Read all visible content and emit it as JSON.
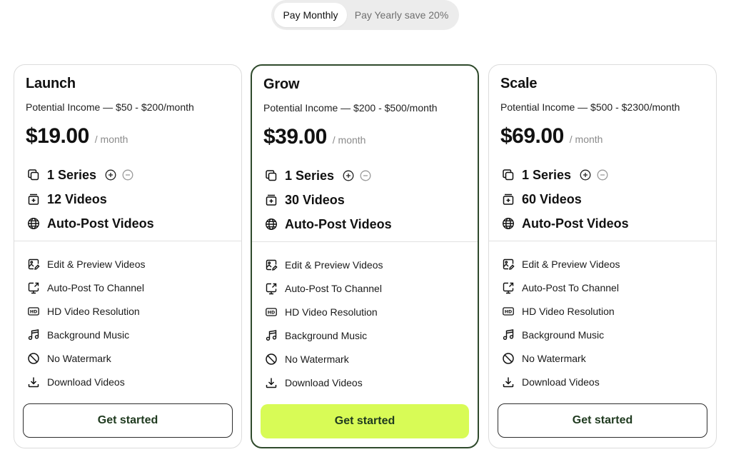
{
  "toggle": {
    "monthly": "Pay Monthly",
    "yearly": "Pay Yearly save 20%"
  },
  "plans": [
    {
      "name": "Launch",
      "income": "Potential Income — $50 - $200/month",
      "price": "$19.00",
      "per": "/ month",
      "series": "1 Series",
      "videos": "12 Videos",
      "autopost": "Auto-Post Videos",
      "cta": "Get started"
    },
    {
      "name": "Grow",
      "income": "Potential Income —  $200 - $500/month",
      "price": "$39.00",
      "per": "/ month",
      "series": "1 Series",
      "videos": "30 Videos",
      "autopost": "Auto-Post Videos",
      "cta": "Get started"
    },
    {
      "name": "Scale",
      "income": "Potential Income —  $500 - $2300/month",
      "price": "$69.00",
      "per": "/ month",
      "series": "1 Series",
      "videos": "60 Videos",
      "autopost": "Auto-Post Videos",
      "cta": "Get started"
    }
  ],
  "features": [
    {
      "label": "Edit & Preview Videos",
      "icon": "image-edit-icon"
    },
    {
      "label": "Auto-Post To Channel",
      "icon": "monitor-share-icon"
    },
    {
      "label": "HD Video Resolution",
      "icon": "hd-icon"
    },
    {
      "label": "Background Music",
      "icon": "music-note-icon"
    },
    {
      "label": "No Watermark",
      "icon": "no-symbol-icon"
    },
    {
      "label": "Download Videos",
      "icon": "download-icon"
    }
  ],
  "colors": {
    "featured_border": "#2f4a2c",
    "cta_featured_bg": "#d8fb56",
    "cta_text": "#1f3a1f"
  }
}
